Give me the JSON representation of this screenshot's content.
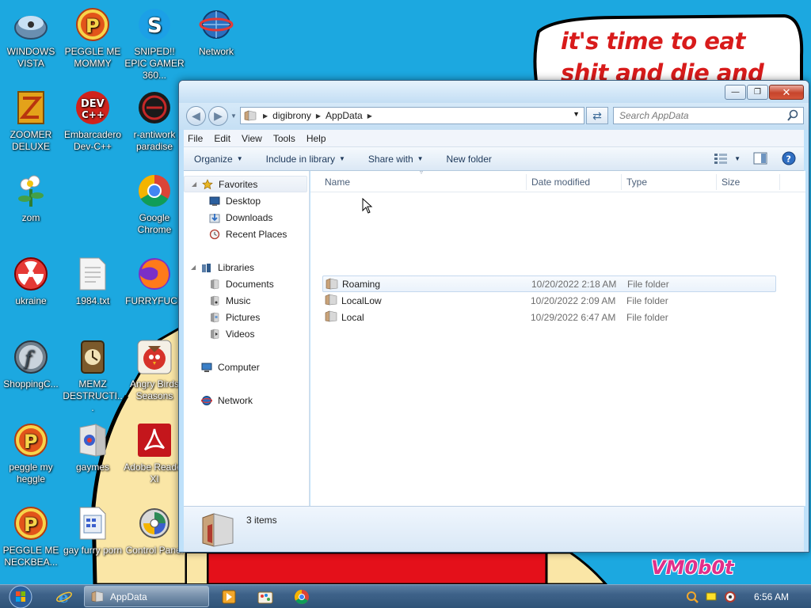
{
  "wallpaper": {
    "text": "it's time to eat shit and die and chew",
    "signature": "VM0b0t"
  },
  "desktop_icons": [
    {
      "label": "WINDOWS VISTA",
      "icon": "orb-icon"
    },
    {
      "label": "PEGGLE ME MOMMY",
      "icon": "peggle-icon"
    },
    {
      "label": "SNIPED!! EPIC GAMER 360...",
      "icon": "skype-icon"
    },
    {
      "label": "Network",
      "icon": "network-icon"
    },
    {
      "label": "ZOOMER DELUXE",
      "icon": "zuma-icon"
    },
    {
      "label": "Embarcadero Dev-C++",
      "icon": "devcpp-icon"
    },
    {
      "label": "r-antiwork paradise",
      "icon": "reddit-icon"
    },
    {
      "label": "zom",
      "icon": "plant-icon"
    },
    {
      "label": "Google Chrome",
      "icon": "chrome-icon"
    },
    {
      "label": "ukraine",
      "icon": "radiation-icon"
    },
    {
      "label": "1984.txt",
      "icon": "text-file-icon"
    },
    {
      "label": "FURRYFUCK",
      "icon": "firefox-icon"
    },
    {
      "label": "ShoppingC...",
      "icon": "flash-icon"
    },
    {
      "label": "MEMZ DESTRUCTI...",
      "icon": "memz-icon"
    },
    {
      "label": "Angry Birds Seasons",
      "icon": "angry-birds-icon"
    },
    {
      "label": "peggle my heggle",
      "icon": "peggle-icon"
    },
    {
      "label": "gaymes",
      "icon": "games-folder-icon"
    },
    {
      "label": "Adobe Reader XI",
      "icon": "adobe-reader-icon"
    },
    {
      "label": "PEGGLE ME NECKBEA...",
      "icon": "peggle-icon"
    },
    {
      "label": "gay furry porn",
      "icon": "html-file-icon"
    },
    {
      "label": "Control Panel",
      "icon": "control-panel-icon"
    }
  ],
  "window": {
    "caption_buttons": {
      "minimize": "—",
      "maximize": "❐",
      "close": "✕"
    },
    "breadcrumbs": [
      "digibrony",
      "AppData"
    ],
    "search_placeholder": "Search AppData",
    "menu": [
      "File",
      "Edit",
      "View",
      "Tools",
      "Help"
    ],
    "commands": {
      "organize": "Organize",
      "include": "Include in library",
      "share": "Share with",
      "new_folder": "New folder"
    },
    "nav": {
      "favorites": "Favorites",
      "desktop": "Desktop",
      "downloads": "Downloads",
      "recent": "Recent Places",
      "libraries": "Libraries",
      "documents": "Documents",
      "music": "Music",
      "pictures": "Pictures",
      "videos": "Videos",
      "computer": "Computer",
      "network": "Network"
    },
    "columns": {
      "name": "Name",
      "date": "Date modified",
      "type": "Type",
      "size": "Size"
    },
    "files": [
      {
        "name": "Roaming",
        "date": "10/20/2022 2:18 AM",
        "type": "File folder"
      },
      {
        "name": "LocalLow",
        "date": "10/20/2022 2:09 AM",
        "type": "File folder"
      },
      {
        "name": "Local",
        "date": "10/29/2022 6:47 AM",
        "type": "File folder"
      }
    ],
    "status": "3 items"
  },
  "taskbar": {
    "active_app": "AppData",
    "clock": "6:56 AM",
    "pinned": [
      "ie-icon",
      "media-player-icon",
      "paint-icon",
      "chrome-icon"
    ]
  },
  "colors": {
    "desktop_bg": "#1ca8e0",
    "wall_text": "#d81b1b",
    "window_frame": "#bfe1fa"
  }
}
